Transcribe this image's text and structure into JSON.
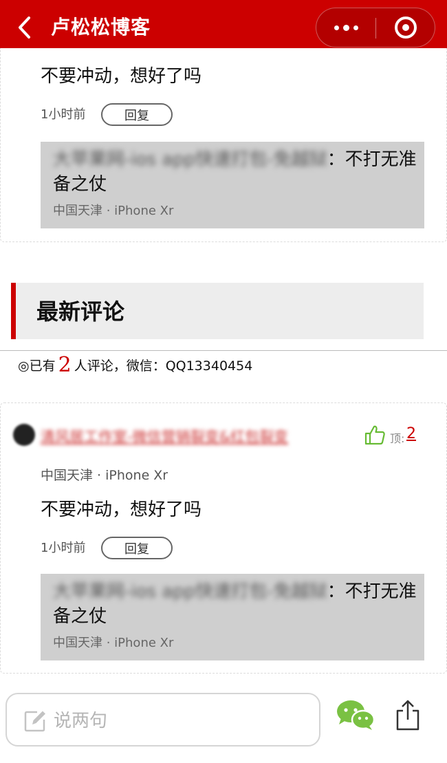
{
  "header": {
    "title": "卢松松博客",
    "colors": {
      "brand": "#cc0000"
    }
  },
  "comments": [
    {
      "text": "不要冲动，想好了吗",
      "time": "1小时前",
      "reply_label": "回复",
      "quote": {
        "blurred_source": "大苹果网-ios app快速打包-免越狱",
        "text": "：不打无准备之仗",
        "meta": "中国天津 · iPhone Xr"
      }
    },
    {
      "author": "清风居工作室-微信营销裂变&红包裂变",
      "location": "中国天津 · iPhone Xr",
      "like_label": "顶:",
      "like_count": "2",
      "text": "不要冲动，想好了吗",
      "time": "1小时前",
      "reply_label": "回复",
      "quote": {
        "blurred_source": "大苹果网-ios app快速打包-免越狱",
        "text": "：不打无准备之仗",
        "meta": "中国天津 · iPhone Xr"
      }
    }
  ],
  "section": {
    "title": "最新评论",
    "count_prefix": "◎已有",
    "count": "2",
    "count_suffix": "人评论，微信：QQ13340454"
  },
  "bottom_bar": {
    "placeholder": "说两句"
  }
}
